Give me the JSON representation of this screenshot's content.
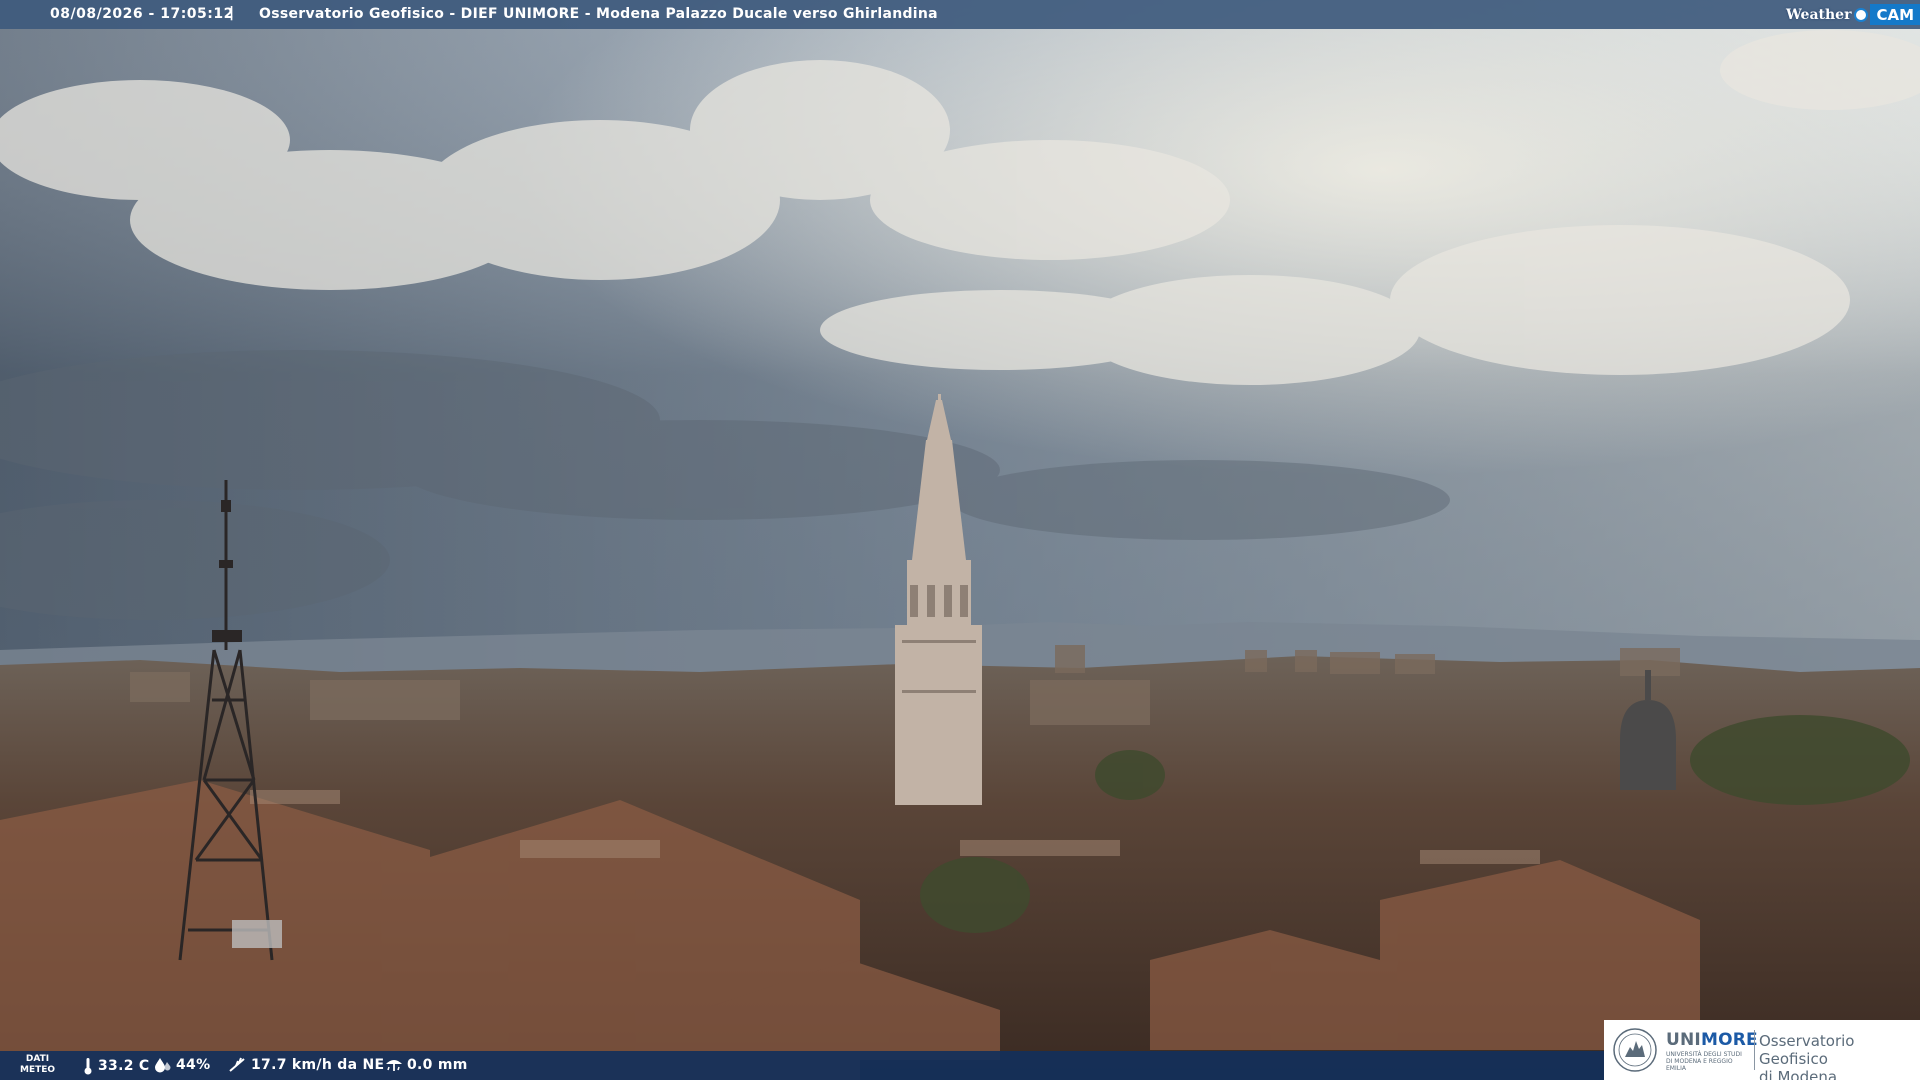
{
  "header": {
    "timestamp": "08/08/2026 - 17:05:12",
    "separator": "|",
    "title": "Osservatorio Geofisico - DIEF UNIMORE - Modena Palazzo Ducale verso Ghirlandina"
  },
  "brand_logo": {
    "weather": "Weather",
    "cam": "CAM"
  },
  "weather_panel": {
    "label_line1": "DATI",
    "label_line2": "METEO",
    "temperature": "33.2 C",
    "humidity": "44%",
    "wind": "17.7 km/h da NE",
    "rain": "0.0 mm"
  },
  "footer_logo": {
    "brand_a": "UNI",
    "brand_b": "MORE",
    "university": "UNIVERSITÀ DEGLI STUDI DI MODENA E REGGIO EMILIA",
    "observatory_line1": "Osservatorio Geofisico",
    "observatory_line2": "di Modena"
  },
  "colors": {
    "topbar": "#3e5a7d",
    "bottombar": "#12305c",
    "unimore_blue": "#1c5aa6",
    "weathercam_blue": "#1479c9"
  }
}
